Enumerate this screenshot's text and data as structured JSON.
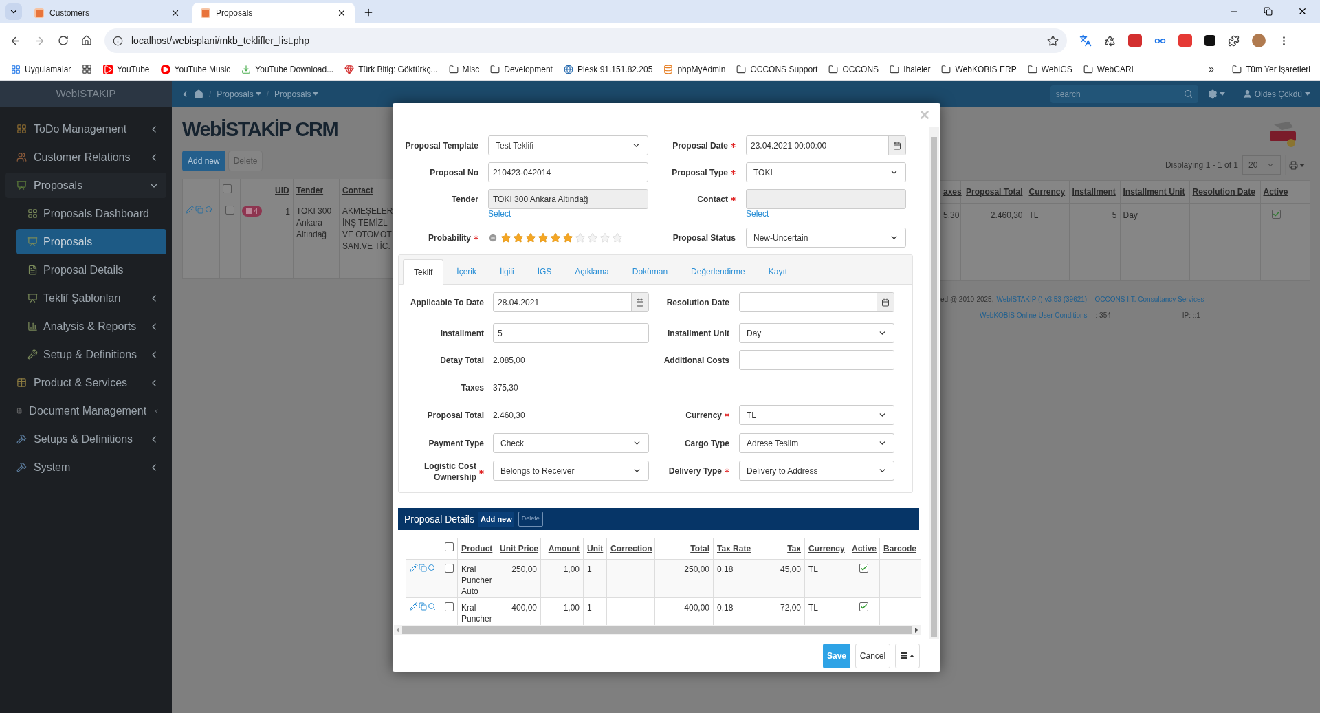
{
  "browser": {
    "tabs": [
      {
        "title": "Customers",
        "selected": false
      },
      {
        "title": "Proposals",
        "selected": true
      }
    ],
    "address": "localhost/webisplani/mkb_teklifler_list.php",
    "bookmarks": [
      {
        "label": "Uygulamalar",
        "kind": "apps"
      },
      {
        "label": "YouTube",
        "kind": "youtube"
      },
      {
        "label": "YouTube Music",
        "kind": "music"
      },
      {
        "label": "YouTube Download...",
        "kind": "download"
      },
      {
        "label": "Türk Bitig: Göktürkç...",
        "kind": "gem"
      },
      {
        "label": "Misc",
        "kind": "folder"
      },
      {
        "label": "Development",
        "kind": "folder"
      },
      {
        "label": "Plesk 91.151.82.205",
        "kind": "site"
      },
      {
        "label": "phpMyAdmin",
        "kind": "pma"
      },
      {
        "label": "OCCONS Support",
        "kind": "folder"
      },
      {
        "label": "OCCONS",
        "kind": "folder"
      },
      {
        "label": "Ihaleler",
        "kind": "folder"
      },
      {
        "label": "WebKOBIS ERP",
        "kind": "folder"
      },
      {
        "label": "WebIGS",
        "kind": "folder"
      },
      {
        "label": "WebCARI",
        "kind": "folder"
      }
    ],
    "more": "»",
    "all_bookmarks": "Tüm Yer İşaretleri"
  },
  "app": {
    "brand": "WebISTAKIP",
    "breadcrumb_separator": "/",
    "breadcrumb": [
      "Proposals",
      "Proposals"
    ],
    "search": {
      "placeholder": "search"
    },
    "user": "Oldes Çökdü"
  },
  "sidebar": {
    "items": [
      {
        "label": "ToDo Management",
        "selected": false,
        "expanded": false
      },
      {
        "label": "Customer Relations",
        "selected": false,
        "expanded": false
      },
      {
        "label": "Proposals",
        "selected": false,
        "expanded": true,
        "children": [
          {
            "label": "Proposals Dashboard",
            "selected": false
          },
          {
            "label": "Proposals",
            "selected": true
          },
          {
            "label": "Proposal Details",
            "selected": false
          },
          {
            "label": "Teklif Şablonları",
            "selected": false,
            "expanded": false
          },
          {
            "label": "Analysis & Reports",
            "selected": false,
            "expanded": false
          },
          {
            "label": "Setup & Definitions",
            "selected": false,
            "expanded": false
          }
        ]
      },
      {
        "label": "Product & Services",
        "selected": false,
        "expanded": false
      },
      {
        "label": "Document Management",
        "selected": false,
        "expanded": false
      },
      {
        "label": "Setups & Definitions",
        "selected": false,
        "expanded": false
      },
      {
        "label": "System",
        "selected": false,
        "expanded": false
      }
    ]
  },
  "list_page": {
    "logo": "WebİSTAKİP CRM",
    "buttons": [
      "Add new",
      "Delete"
    ],
    "displaying": "Displaying 1 - 1 of 1",
    "page_size": "20",
    "select_all": false,
    "left_columns": [
      "UID",
      "Tender",
      "Contact"
    ],
    "left_row": {
      "selected": false,
      "badge": "4",
      "uid": "1",
      "tender": "TOKI 300 Ankara Altındağ",
      "contact": [
        "AKMEŞELER",
        "İNŞ TEMİZL",
        "VE OTOMOT",
        "SAN.VE TİC."
      ]
    },
    "right_columns": [
      "axes",
      "Proposal Total",
      "Currency",
      "Installment",
      "Installment Unit",
      "Resolution Date",
      "Active"
    ],
    "right_row": {
      "taxes": "5,30",
      "proposal_total": "2.460,30",
      "currency": "TL",
      "installment": "5",
      "installment_unit": "Day",
      "active": true
    },
    "footer": {
      "prefix": "ed @ 2010-2025,",
      "version_link": "WebISTAKIP () v3.53 (39621)",
      "separator": "-",
      "company_link": "OCCONS I.T. Consultancy Services",
      "conditions_link": "WebKOBIS Online User Conditions",
      "count": ": 354",
      "ip": "IP: ::1"
    }
  },
  "form": {
    "rows": [
      {
        "left": {
          "label": "Proposal Template",
          "required": false,
          "kind": "select",
          "value": "Test Teklifi"
        },
        "right": {
          "label": "Proposal Date",
          "required": true,
          "kind": "date",
          "value": "23.04.2021 00:00:00"
        }
      },
      {
        "left": {
          "label": "Proposal No",
          "required": false,
          "kind": "input",
          "value": "210423-042014"
        },
        "right": {
          "label": "Proposal Type",
          "required": true,
          "kind": "select",
          "value": "TOKI"
        }
      },
      {
        "left": {
          "label": "Tender",
          "required": false,
          "kind": "readonly",
          "value": "TOKI 300 Ankara Altındağ",
          "link": "Select"
        },
        "right": {
          "label": "Contact",
          "required": true,
          "kind": "readonly",
          "link": "Select"
        }
      },
      {
        "left": {
          "label": "Probability",
          "required": true,
          "kind": "stars",
          "stars": 6
        },
        "right": {
          "label": "Proposal Status",
          "required": false,
          "kind": "select",
          "value": "New-Uncertain"
        }
      }
    ],
    "tabs": [
      {
        "label": "Teklif",
        "selected": true
      },
      {
        "label": "İçerik",
        "selected": false
      },
      {
        "label": "İlgili",
        "selected": false
      },
      {
        "label": "İGS",
        "selected": false
      },
      {
        "label": "Açıklama",
        "selected": false
      },
      {
        "label": "Doküman",
        "selected": false
      },
      {
        "label": "Değerlendirme",
        "selected": false
      },
      {
        "label": "Kayıt",
        "selected": false
      }
    ],
    "tab_rows": [
      {
        "left": {
          "label": "Applicable To Date",
          "required": false,
          "kind": "date",
          "value": "28.04.2021"
        },
        "right": {
          "label": "Resolution Date",
          "required": false,
          "kind": "date"
        }
      },
      {
        "left": {
          "label": "Installment",
          "required": false,
          "kind": "input",
          "value": "5"
        },
        "right": {
          "label": "Installment Unit",
          "required": false,
          "kind": "select",
          "value": "Day"
        }
      },
      {
        "left": {
          "label": "Detay Total",
          "required": false,
          "kind": "text",
          "value": "2.085,00"
        },
        "right": {
          "label": "Additional Costs",
          "required": false,
          "kind": "input"
        }
      },
      {
        "left": {
          "label": "Taxes",
          "required": false,
          "kind": "text",
          "value": "375,30"
        }
      },
      {
        "left": {
          "label": "Proposal Total",
          "required": false,
          "kind": "text",
          "value": "2.460,30"
        },
        "right": {
          "label": "Currency",
          "required": true,
          "kind": "select",
          "value": "TL"
        }
      },
      {
        "left": {
          "label": "Payment Type",
          "required": false,
          "kind": "select",
          "value": "Check"
        },
        "right": {
          "label": "Cargo Type",
          "required": false,
          "kind": "select",
          "value": "Adrese Teslim"
        }
      },
      {
        "left": {
          "label": "Logistic Cost Ownership",
          "required": true,
          "kind": "select",
          "value": "Belongs to Receiver"
        },
        "right": {
          "label": "Delivery Type",
          "required": true,
          "kind": "select",
          "value": "Delivery to Address"
        }
      }
    ],
    "details": {
      "title": "Proposal Details",
      "add_new": "Add new",
      "delete": {
        "label": "Delete",
        "disabled": true
      },
      "select_all": false,
      "columns": [
        "Product",
        "Unit Price",
        "Amount",
        "Unit",
        "Correction",
        "Total",
        "Tax Rate",
        "Tax",
        "Currency",
        "Active",
        "Barcode"
      ],
      "rows": [
        {
          "selected": false,
          "product": "Kral Puncher Auto",
          "unit_price": "250,00",
          "amount": "1,00",
          "unit": "1",
          "total": "250,00",
          "tax_rate": "0,18",
          "tax": "45,00",
          "currency": "TL",
          "active": true
        },
        {
          "selected": false,
          "product": "Kral Puncher",
          "unit_price": "400,00",
          "amount": "1,00",
          "unit": "1",
          "total": "400,00",
          "tax_rate": "0,18",
          "tax": "72,00",
          "currency": "TL",
          "active": true
        }
      ]
    },
    "buttons": {
      "save": "Save",
      "cancel": "Cancel"
    }
  }
}
